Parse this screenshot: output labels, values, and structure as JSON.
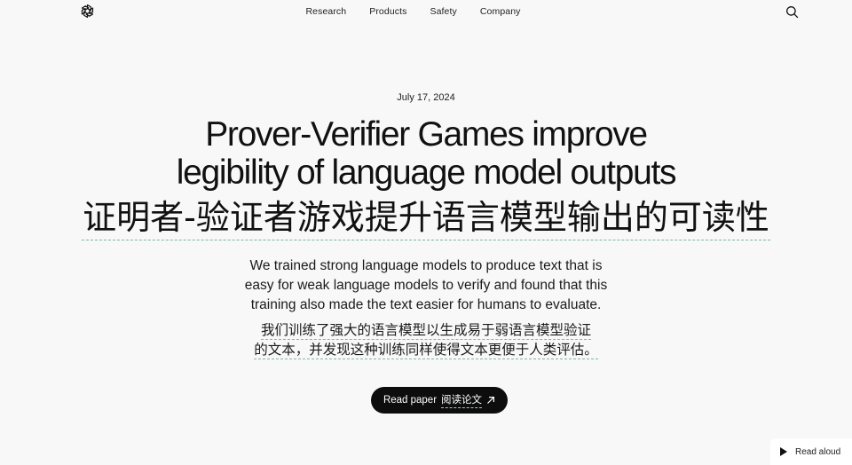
{
  "nav": {
    "links": [
      "Research",
      "Products",
      "Safety",
      "Company"
    ],
    "logo_icon": "openai-logo-icon",
    "search_icon": "search-icon"
  },
  "article": {
    "date": "July 17, 2024",
    "title_en_line1": "Prover-Verifier Games improve",
    "title_en_line2": "legibility of language model outputs",
    "title_zh": "证明者-验证者游戏提升语言模型输出的可读性",
    "subtitle_en_line1": "We trained strong language models to produce text that is",
    "subtitle_en_line2": "easy for weak language models to verify and found that this",
    "subtitle_en_line3": "training also made the text easier for humans to evaluate.",
    "subtitle_zh_line1": "我们训练了强大的语言模型以生成易于弱语言模型验证",
    "subtitle_zh_line2": "的文本，并发现这种训练同样使得文本更便于人类评估。"
  },
  "cta": {
    "label_en": "Read paper",
    "label_zh": "阅读论文",
    "icon": "arrow-up-right-icon"
  },
  "read_aloud": {
    "label": "Read aloud",
    "icon": "play-icon"
  },
  "colors": {
    "background": "#f8f8f8",
    "button": "#0d0d0d",
    "dashed_underline": "#7fb6a6"
  }
}
